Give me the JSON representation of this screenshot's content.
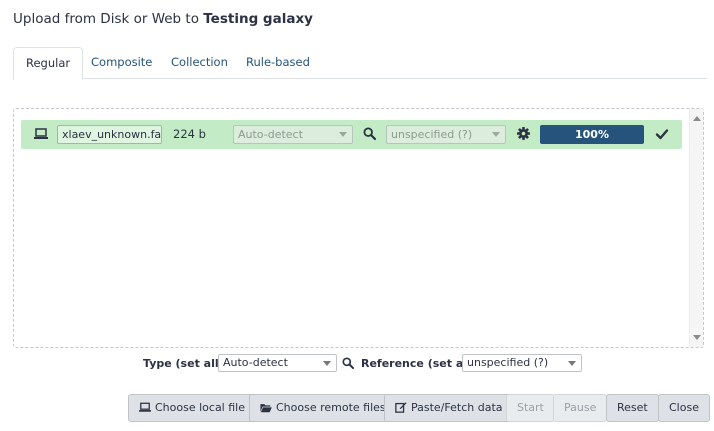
{
  "dialog": {
    "title_prefix": "Upload from Disk or Web to",
    "title_target": "Testing galaxy"
  },
  "tabs": [
    {
      "label": "Regular",
      "active": true
    },
    {
      "label": "Composite",
      "active": false
    },
    {
      "label": "Collection",
      "active": false
    },
    {
      "label": "Rule-based",
      "active": false
    }
  ],
  "upload_row": {
    "source_icon": "laptop-icon",
    "filename": "xlaev_unknown.fasta",
    "size": "224 b",
    "extension": "Auto-detect",
    "extension_search_icon": "search-icon",
    "dbkey": "unspecified (?)",
    "settings_icon": "gear-icon",
    "progress_percent": 100,
    "progress_label": "100%",
    "status_icon": "check-icon",
    "row_color": "#c3ecc6",
    "progress_color": "#25537b"
  },
  "set_all": {
    "type_label": "Type (set all):",
    "type_value": "Auto-detect",
    "reference_label": "Reference (set all):",
    "reference_value": "unspecified (?)"
  },
  "buttons": {
    "choose_local": "Choose local file",
    "choose_remote": "Choose remote files",
    "paste_fetch": "Paste/Fetch data",
    "start": "Start",
    "pause": "Pause",
    "reset": "Reset",
    "close": "Close"
  }
}
